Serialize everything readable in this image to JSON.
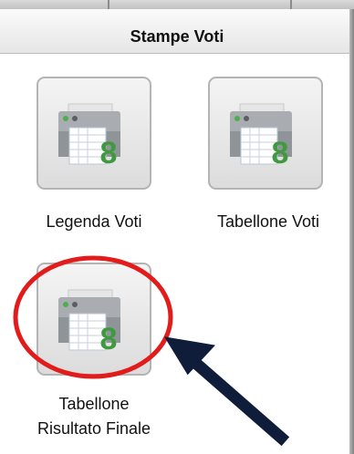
{
  "panel": {
    "title": "Stampe Voti"
  },
  "items": [
    {
      "label": "Legenda Voti",
      "icon": "printer-grades-icon",
      "badge": "8"
    },
    {
      "label": "Tabellone Voti",
      "icon": "printer-grades-icon",
      "badge": "8"
    },
    {
      "label_line1": "Tabellone",
      "label_line2": "Risultato Finale",
      "icon": "printer-grades-icon",
      "badge": "8"
    }
  ],
  "colors": {
    "accent_green": "#3f9a3f",
    "highlight_circle": "#e21b1b",
    "arrow": "#0f1c3a"
  }
}
